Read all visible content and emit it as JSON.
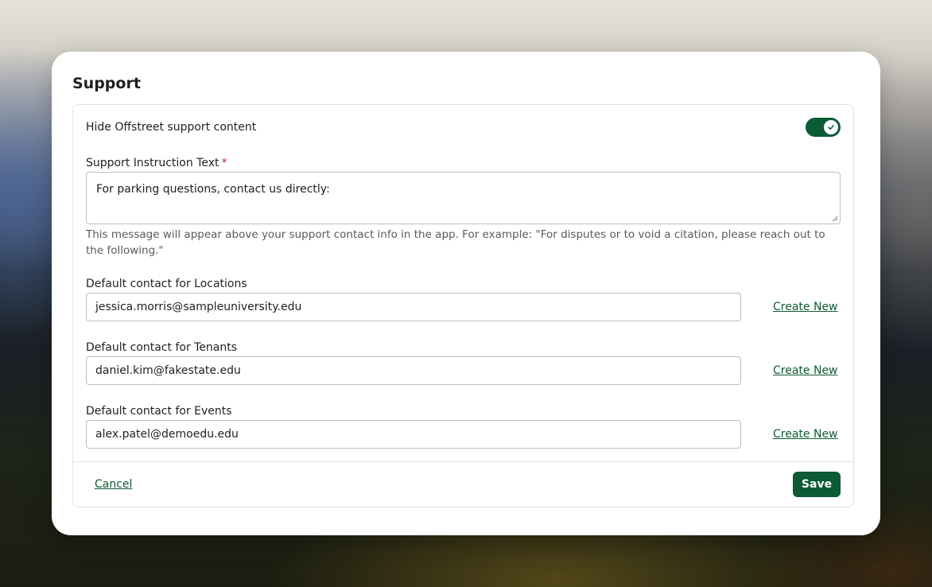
{
  "modal": {
    "title": "Support"
  },
  "toggle": {
    "label": "Hide Offstreet support content",
    "checked": true,
    "icon": "check-icon"
  },
  "instruction": {
    "label": "Support Instruction Text",
    "required_marker": "*",
    "value": "For parking questions, contact us directly:",
    "helper": "This message will appear above your support contact info in the app. For example: \"For disputes or to void a citation, please reach out to the following.\""
  },
  "contacts": [
    {
      "label": "Default contact for Locations",
      "value": "jessica.morris@sampleuniversity.edu",
      "action": "Create New"
    },
    {
      "label": "Default contact for Tenants",
      "value": "daniel.kim@fakestate.edu",
      "action": "Create New"
    },
    {
      "label": "Default contact for Events",
      "value": "alex.patel@demoedu.edu",
      "action": "Create New"
    }
  ],
  "footer": {
    "cancel_label": "Cancel",
    "save_label": "Save"
  },
  "colors": {
    "accent": "#0d5a36",
    "required": "#c0282b",
    "border": "#bdbdbd",
    "helper_text": "#5a5a5a"
  }
}
